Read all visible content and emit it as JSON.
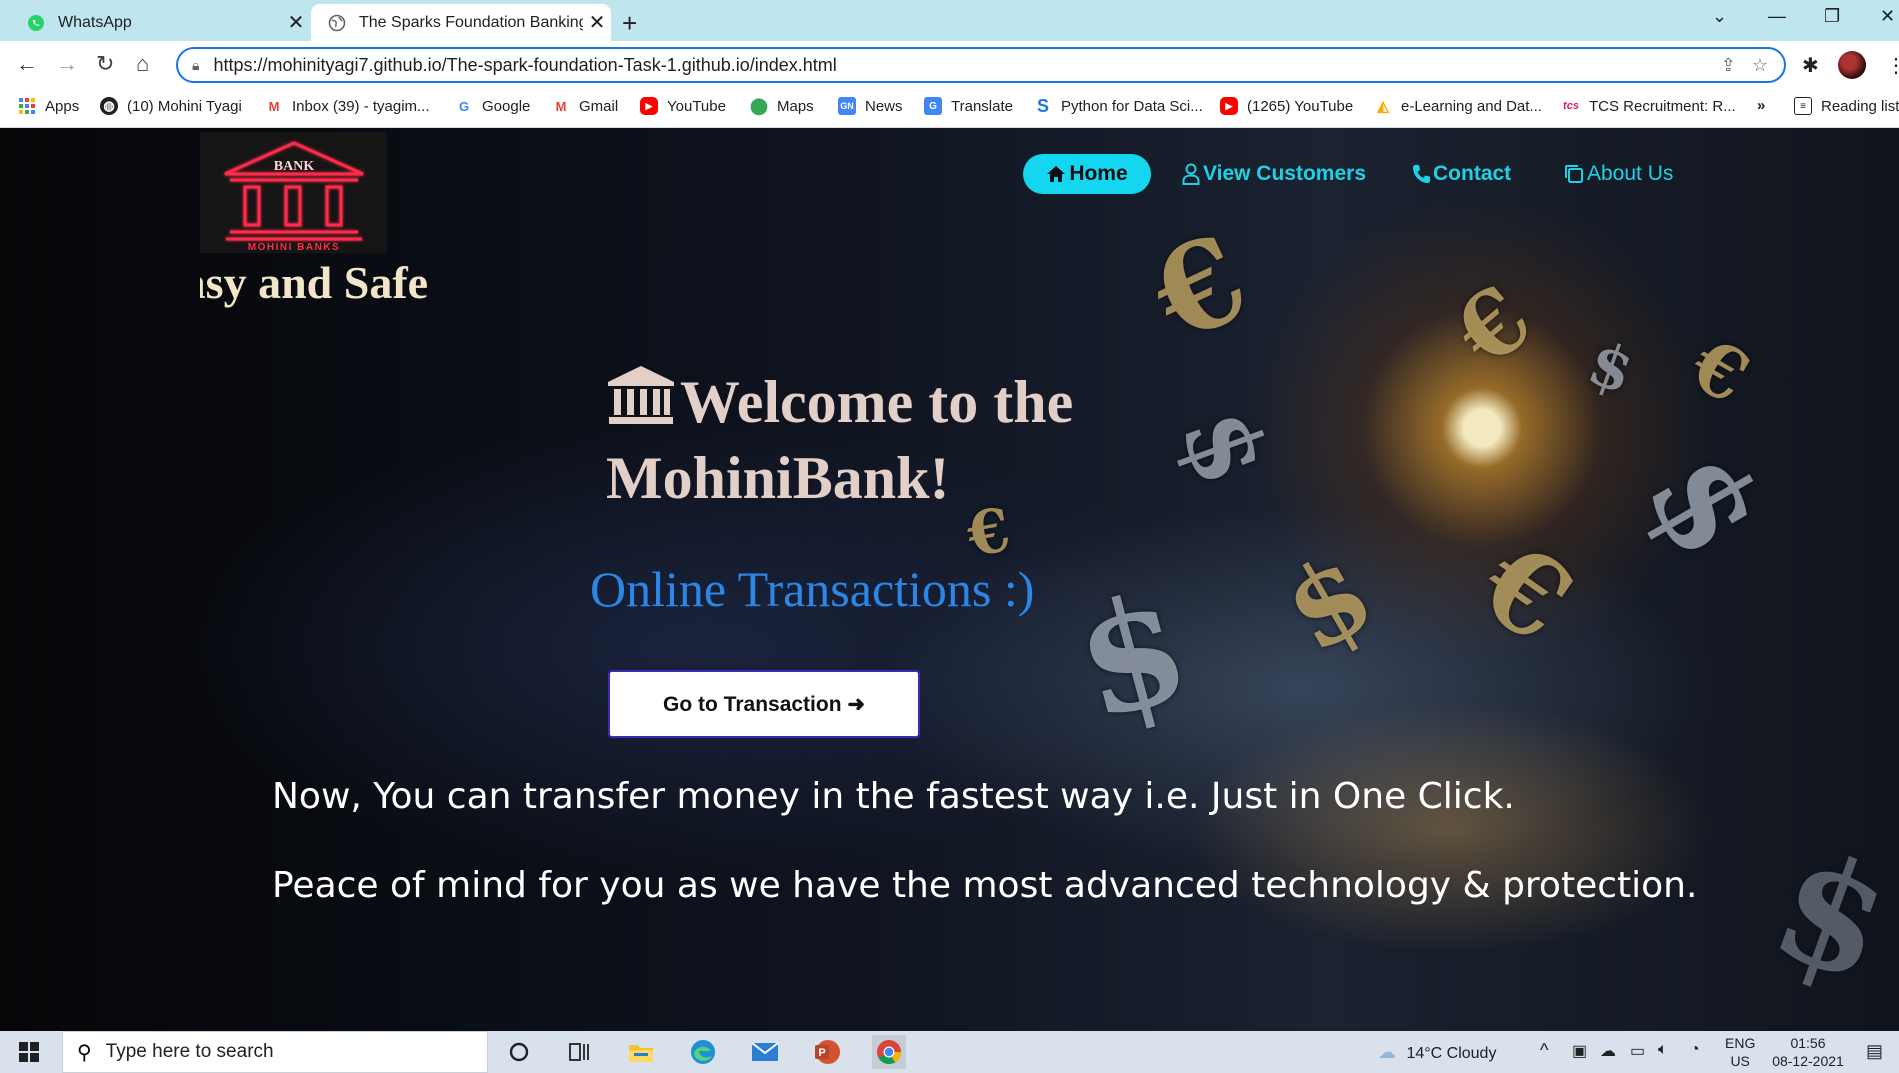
{
  "tabs": [
    {
      "title": "WhatsApp",
      "favicon": "whatsapp-icon",
      "active": false
    },
    {
      "title": "The Sparks Foundation Banking S",
      "favicon": "globe-icon",
      "active": true
    }
  ],
  "address_bar": {
    "url": "https://mohinityagi7.github.io/The-spark-foundation-Task-1.github.io/index.html"
  },
  "bookmarks": [
    {
      "label": "Apps",
      "icon": "apps-grid-icon"
    },
    {
      "label": "(10) Mohini Tyagi",
      "icon": "globe-icon"
    },
    {
      "label": "Inbox (39) - tyagim...",
      "icon": "gmail-icon"
    },
    {
      "label": "Google",
      "icon": "google-icon"
    },
    {
      "label": "Gmail",
      "icon": "gmail-icon"
    },
    {
      "label": "YouTube",
      "icon": "youtube-icon"
    },
    {
      "label": "Maps",
      "icon": "maps-icon"
    },
    {
      "label": "News",
      "icon": "news-icon"
    },
    {
      "label": "Translate",
      "icon": "translate-icon"
    },
    {
      "label": "Python for Data Sci...",
      "icon": "site-s-icon"
    },
    {
      "label": "(1265) YouTube",
      "icon": "youtube-icon"
    },
    {
      "label": "e-Learning and Dat...",
      "icon": "elearning-icon"
    },
    {
      "label": "TCS Recruitment: R...",
      "icon": "tcs-icon"
    }
  ],
  "bookmarks_overflow": "»",
  "reading_list": "Reading list",
  "site": {
    "logo": {
      "top_text": "BANK",
      "bottom_text": "MOHINI BANKS"
    },
    "tagline": "Easy and Safe",
    "nav": [
      {
        "label": "Home",
        "icon": "home-icon"
      },
      {
        "label": "View Customers",
        "icon": "user-icon"
      },
      {
        "label": "Contact",
        "icon": "phone-icon"
      },
      {
        "label": "About Us",
        "icon": "copy-icon"
      }
    ],
    "welcome_line1": "Welcome to the",
    "welcome_line2": "MohiniBank!",
    "subheading": "Online Transactions :)",
    "cta_button": "Go to Transaction ➜",
    "lead1": "Now, You can transfer money in the fastest way i.e. Just in One Click.",
    "lead2": "Peace of mind for you as we have the most advanced technology & protection."
  },
  "taskbar": {
    "search_placeholder": "Type here to search",
    "weather": "14°C  Cloudy",
    "language_top": "ENG",
    "language_bottom": "US",
    "time": "01:56",
    "date": "08-12-2021"
  },
  "colors": {
    "accent_cyan": "#14d6ee",
    "subheading_blue": "#2b86e6",
    "tab_strip": "#bfe6ef",
    "logo_red": "#ff2a4a"
  }
}
